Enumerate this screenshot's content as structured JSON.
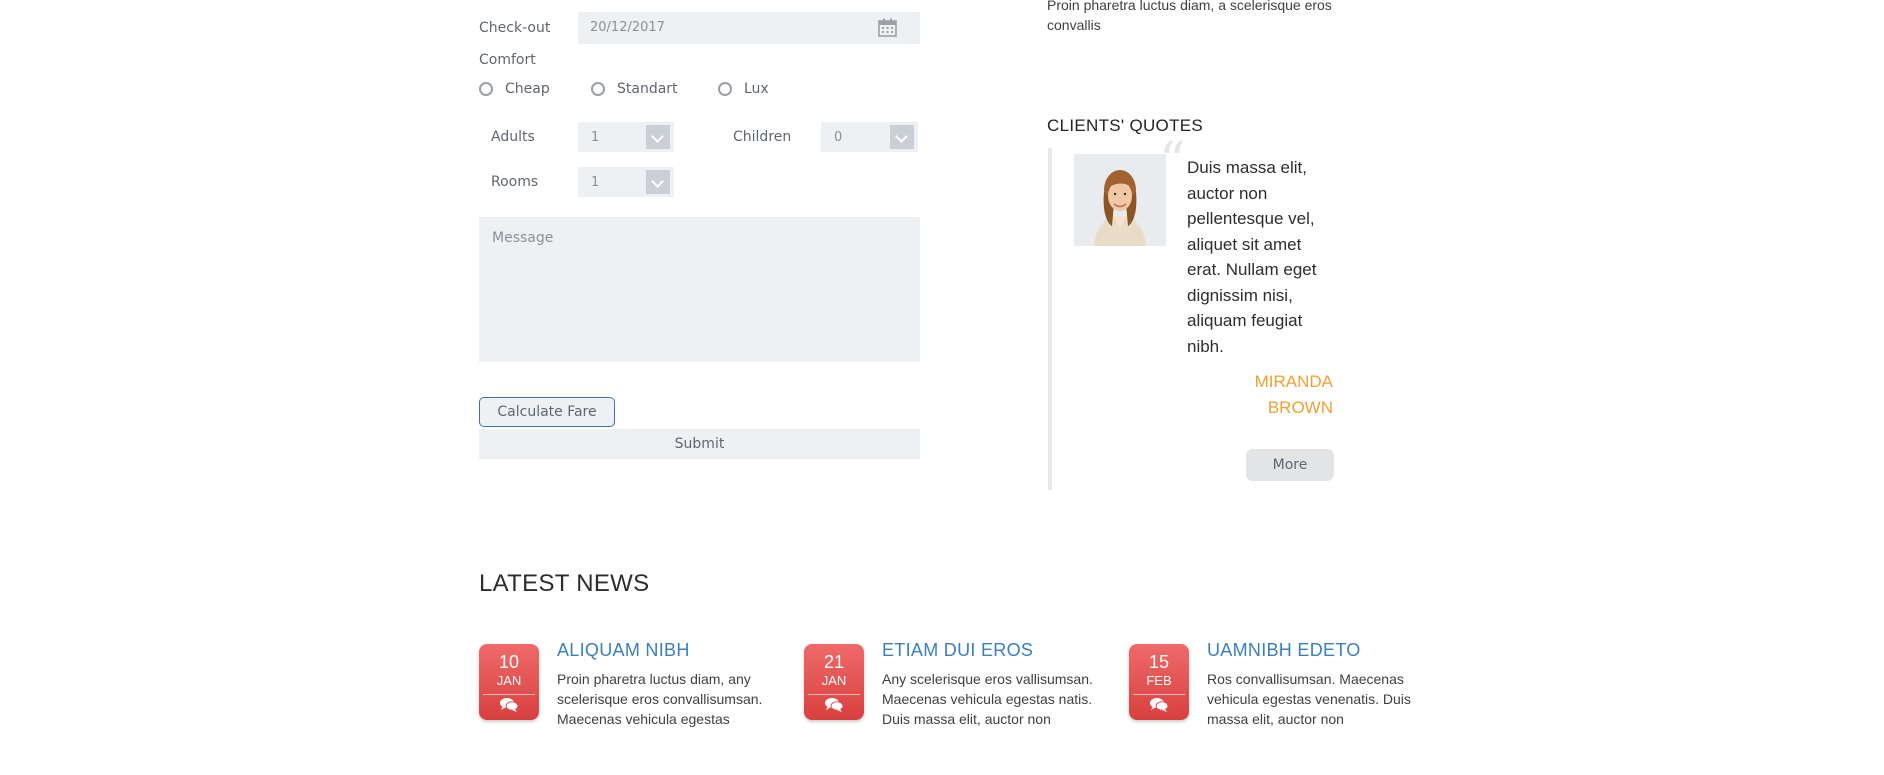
{
  "form": {
    "checkout_label": "Check-out",
    "checkout_value": "20/12/2017",
    "comfort_label": "Comfort",
    "comfort_options": [
      "Cheap",
      "Standart",
      "Lux"
    ],
    "adults_label": "Adults",
    "adults_value": "1",
    "children_label": "Children",
    "children_value": "0",
    "rooms_label": "Rooms",
    "rooms_value": "1",
    "message_placeholder": "Message",
    "calculate_label": "Calculate Fare",
    "submit_label": "Submit"
  },
  "sidebar": {
    "top_text": "Proin pharetra luctus diam, a scelerisque eros convallis",
    "quotes_title": "CLIENTS' QUOTES",
    "quote_text": "Duis massa elit, auctor non pellentesque vel, aliquet sit amet erat. Nullam eget dignissim nisi, aliquam feugiat nibh.",
    "quote_author_first": "MIRANDA",
    "quote_author_last": "BROWN",
    "more_label": "More"
  },
  "news": {
    "title": "LATEST NEWS",
    "items": [
      {
        "day": "10",
        "month": "JAN",
        "title": "ALIQUAM NIBH",
        "text": "Proin pharetra luctus diam, any scelerisque eros convallisumsan. Maecenas vehicula egestas"
      },
      {
        "day": "21",
        "month": "JAN",
        "title": "ETIAM DUI EROS",
        "text": "Any scelerisque eros vallisumsan. Maecenas vehicula egestas natis. Duis massa elit, auctor non"
      },
      {
        "day": "15",
        "month": "FEB",
        "title": "UAMNIBH EDETO",
        "text": "Ros convallisumsan. Maecenas vehicula egestas venenatis. Duis massa elit, auctor non"
      }
    ]
  },
  "colors": {
    "accent_orange": "#f0a030",
    "link_blue": "#3a7fc0",
    "badge_red": "#e05252"
  }
}
